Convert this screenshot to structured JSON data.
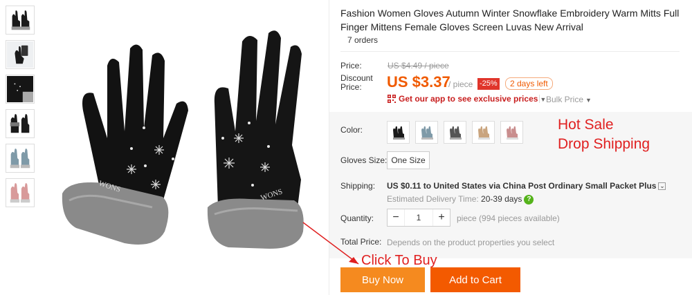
{
  "product": {
    "title": "Fashion Women Gloves Autumn Winter Snowflake Embroidery Warm Mitts Full Finger Mittens Female Gloves Screen Luvas New Arrival",
    "orders": "7 orders",
    "image_text": "WONS"
  },
  "price": {
    "label": "Price:",
    "original": "US $4.49 / piece",
    "discount_label": "Discount Price:",
    "discount_value": "US $3.37",
    "per_piece": "/ piece",
    "off_badge": "-25%",
    "days_left": "2 days left",
    "app_promo": "Get our app to see exclusive prices",
    "bulk_price": "Bulk Price"
  },
  "overlay": {
    "hot_sale_line1": "Hot Sale",
    "hot_sale_line2": "Drop Shipping",
    "click_to_buy": "Click To Buy"
  },
  "specs": {
    "color_label": "Color:",
    "colors": [
      {
        "name": "black",
        "hex": "#1a1a1a"
      },
      {
        "name": "blue",
        "hex": "#7f9aa8"
      },
      {
        "name": "gray",
        "hex": "#555555"
      },
      {
        "name": "khaki",
        "hex": "#c9a47e"
      },
      {
        "name": "pink",
        "hex": "#c98e8e"
      }
    ],
    "size_label": "Gloves Size:",
    "size_value": "One Size",
    "shipping_label": "Shipping:",
    "shipping_cost": "US $0.11",
    "shipping_to": " to ",
    "shipping_dest": "United States via China Post Ordinary Small Packet Plus",
    "delivery_label": "Estimated Delivery Time: ",
    "delivery_value": "20-39 days",
    "quantity_label": "Quantity:",
    "quantity_value": "1",
    "quantity_available": "piece (994 pieces available)",
    "total_label": "Total Price:",
    "total_note": "Depends on the product properties you select"
  },
  "actions": {
    "buy_now": "Buy Now",
    "add_to_cart": "Add to Cart"
  },
  "colors": {
    "accent": "#f05a00",
    "buy": "#f58a1f",
    "cart": "#f35a00",
    "promo_red": "#e02020"
  }
}
